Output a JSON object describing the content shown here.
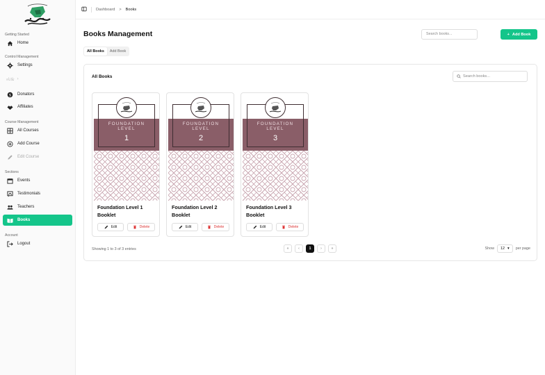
{
  "sidebar": {
    "sections": [
      {
        "label": "Getting Started",
        "items": [
          {
            "label": "Home",
            "icon": "home-icon"
          }
        ]
      },
      {
        "label": "Control Management",
        "items": [
          {
            "label": "Settings",
            "icon": "gear-icon"
          }
        ]
      },
      {
        "label": "Donators",
        "icon": "dollar-icon"
      },
      {
        "label": "Affiliates",
        "icon": "handshake-icon"
      },
      {
        "label": "Course Management",
        "items": [
          {
            "label": "All Courses",
            "icon": "grid-icon"
          },
          {
            "label": "Add Course",
            "icon": "plus-circle-icon"
          },
          {
            "label": "Edit Course",
            "icon": "pencil-icon"
          }
        ]
      },
      {
        "label": "Sections",
        "items": [
          {
            "label": "Events",
            "icon": "calendar-icon"
          },
          {
            "label": "Testimonials",
            "icon": "chat-icon"
          },
          {
            "label": "Teachers",
            "icon": "people-icon"
          },
          {
            "label": "Books",
            "icon": "book-icon"
          }
        ]
      },
      {
        "label": "Account",
        "items": [
          {
            "label": "Logout",
            "icon": "logout-icon"
          }
        ]
      }
    ],
    "faded_text": "ثلاثاء"
  },
  "breadcrumb": {
    "root": "Dashboard",
    "separator": ">",
    "current": "Books"
  },
  "header": {
    "title": "Books Management",
    "search_placeholder": "Search books...",
    "add_label": "Add Book",
    "add_icon": "+"
  },
  "tabs": [
    {
      "label": "All Books"
    },
    {
      "label": "Add Book"
    }
  ],
  "card": {
    "title": "All Books",
    "search_placeholder": "Search books...",
    "books": [
      {
        "title": "Foundation Level 1 Booklet",
        "cover_word": "FOUNDATION",
        "cover_word2": "LEVEL",
        "cover_number": "1"
      },
      {
        "title": "Foundation Level 2 Booklet",
        "cover_word": "FOUNDATION",
        "cover_word2": "LEVEL",
        "cover_number": "2"
      },
      {
        "title": "Foundation Level 3 Booklet",
        "cover_word": "FOUNDATION",
        "cover_word2": "LEVEL",
        "cover_number": "3"
      }
    ],
    "edit_label": "Edit",
    "delete_label": "Delete"
  },
  "pagination": {
    "summary": "Showing 1 to 3 of 3 entries",
    "first": "«",
    "prev": "‹",
    "current": "1",
    "next": "›",
    "last": "»",
    "show_label": "Show",
    "per_page_value": "12",
    "per_page_label": "per page"
  },
  "colors": {
    "accent": "#14c58a",
    "cover_band": "#8a5e68",
    "delete": "#dd3333"
  }
}
